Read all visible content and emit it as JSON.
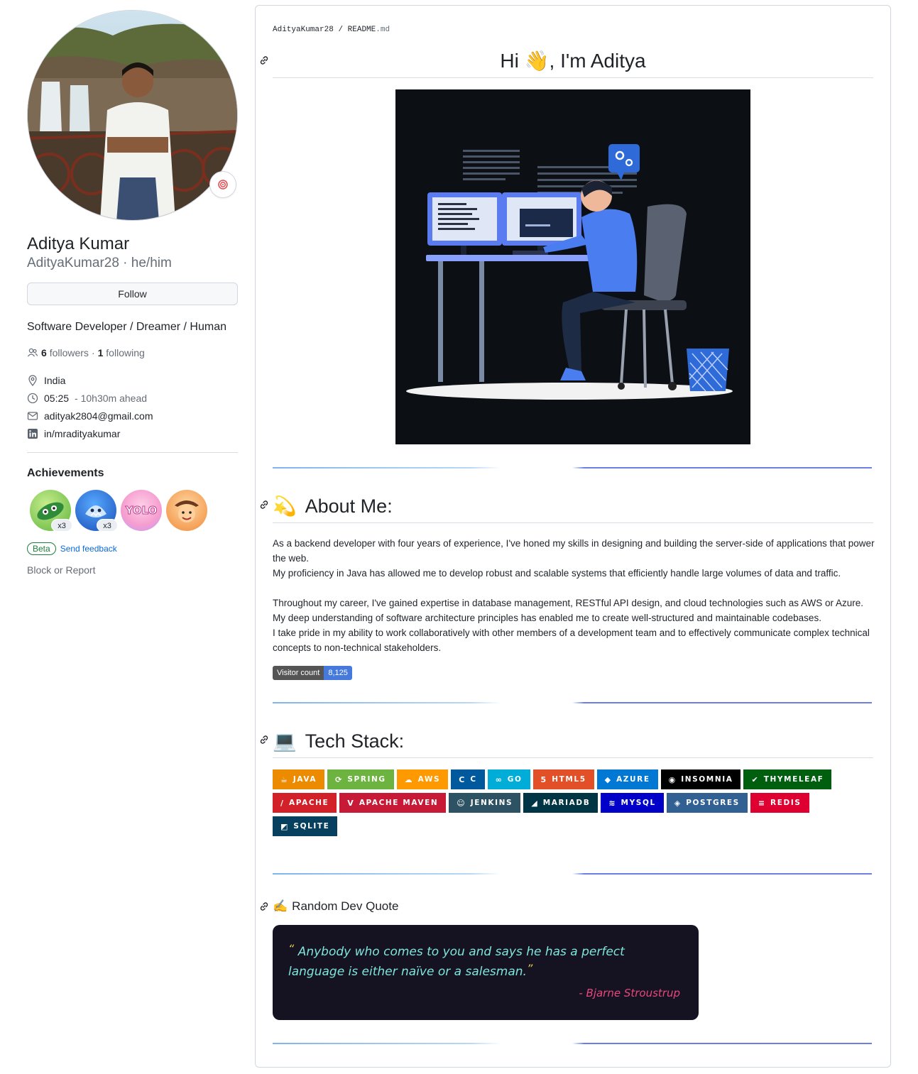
{
  "profile": {
    "fullname": "Aditya Kumar",
    "username_line": "AdityaKumar28 · he/him",
    "follow_label": "Follow",
    "bio": "Software Developer / Dreamer / Human",
    "followers_count": "6",
    "followers_label": "followers",
    "separator": "·",
    "following_count": "1",
    "following_label": "following",
    "location": "India",
    "local_time": "05:25",
    "time_offset": "- 10h30m ahead",
    "email": "adityak2804@gmail.com",
    "linkedin": "in/mradityakumar",
    "achievements_title": "Achievements",
    "badge_counts": [
      "x3",
      "x3"
    ],
    "beta_label": "Beta",
    "feedback_label": "Send feedback",
    "block_label": "Block or Report"
  },
  "readme": {
    "crumb_user": "AdityaKumar28",
    "crumb_sep": "/",
    "crumb_file": "README",
    "crumb_ext": ".md",
    "greeting": "Hi 👋, I'm Aditya",
    "about_emoji": "💫",
    "about_title": "About Me:",
    "about_paragraphs": [
      "As a backend developer with four years of experience, I've honed my skills in designing and building the server-side of applications that power the web.",
      "My proficiency in Java has allowed me to develop robust and scalable systems that efficiently handle large volumes of data and traffic.",
      "Throughout my career, I've gained expertise in database management, RESTful API design, and cloud technologies such as AWS or Azure.",
      "My deep understanding of software architecture principles has enabled me to create well-structured and maintainable codebases.",
      "I take pride in my ability to work collaboratively with other members of a development team and to effectively communicate complex technical concepts to non-technical stakeholders."
    ],
    "visitor_label": "Visitor count",
    "visitor_count": "8,125",
    "tech_emoji": "💻",
    "tech_title": "Tech Stack:",
    "tech_rows": [
      [
        {
          "label": "Java",
          "icon": "☕",
          "color": "#ED8B00"
        },
        {
          "label": "Spring",
          "icon": "⟳",
          "color": "#6DB33F"
        },
        {
          "label": "AWS",
          "icon": "☁",
          "color": "#FF9900"
        },
        {
          "label": "C",
          "icon": "C",
          "color": "#00599C"
        },
        {
          "label": "Go",
          "icon": "∞",
          "color": "#00ADD8"
        },
        {
          "label": "HTML5",
          "icon": "5",
          "color": "#E34F26"
        },
        {
          "label": "Azure",
          "icon": "◆",
          "color": "#0078D4"
        },
        {
          "label": "Insomnia",
          "icon": "◉",
          "color": "#000000"
        },
        {
          "label": "Thymeleaf",
          "icon": "✔",
          "color": "#005F0F"
        }
      ],
      [
        {
          "label": "Apache",
          "icon": "/",
          "color": "#D22128"
        },
        {
          "label": "Apache Maven",
          "icon": "V",
          "color": "#C71A36"
        },
        {
          "label": "Jenkins",
          "icon": "☺",
          "color": "#2C5263"
        },
        {
          "label": "MariaDB",
          "icon": "◢",
          "color": "#003545"
        },
        {
          "label": "MySQL",
          "icon": "≋",
          "color": "#0000C8"
        },
        {
          "label": "Postgres",
          "icon": "◈",
          "color": "#316192"
        },
        {
          "label": "Redis",
          "icon": "≡",
          "color": "#DD0031"
        }
      ],
      [
        {
          "label": "SQLite",
          "icon": "◩",
          "color": "#07405E"
        }
      ]
    ],
    "quote_emoji": "✍️",
    "quote_title": "Random Dev Quote",
    "quote_text": "Anybody who comes to you and says he has a perfect language is either naïve or a salesman.",
    "quote_author": "- Bjarne Stroustrup",
    "quote_open": "“",
    "quote_close": "”"
  },
  "colors": {
    "link": "#0969da",
    "muted": "#656d76",
    "beta": "#1a7f37",
    "visitor_value": "#4679dc",
    "quote_bg": "#151321",
    "quote_text": "#7fe5dc",
    "quote_author": "#e7477c"
  },
  "icons": [
    "target-icon",
    "people-icon",
    "location-icon",
    "clock-icon",
    "mail-icon",
    "linkedin-icon",
    "link-icon",
    "pair-extraordinaire-badge",
    "pull-shark-badge",
    "yolo-badge",
    "quickdraw-badge"
  ]
}
